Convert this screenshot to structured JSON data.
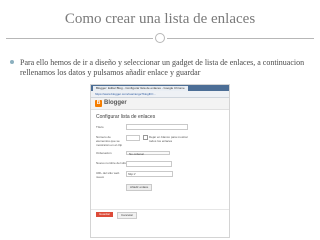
{
  "slide": {
    "title": "Como crear una lista de enlaces",
    "bullet": "Para ello hemos de ir a diseño y seleccionar un gadget de lista de enlaces, a continuacion rellenamos los datos y pulsamos añadir enlace y guardar"
  },
  "screenshot": {
    "browser": {
      "tab_label": "Blogger: Editar Blog - Configurar lista de enlaces - Google Chrome",
      "url": "https://www.blogger.com/rearrange?blogID=..."
    },
    "header": {
      "brand": "Blogger"
    },
    "form": {
      "heading": "Configurar lista de enlaces",
      "fields": {
        "title_label": "Título",
        "max_label": "Número de elementos que se mostrarán en el clip",
        "sort_label": "Ordenación",
        "sort_value": "No ordenar",
        "new_name_label": "Nuevo nombre del sitio",
        "new_url_label": "URL del sitio web nuevo",
        "new_url_value": "http://",
        "add_link_button": "Añadir enlace"
      },
      "checkbox_text": "Dejar en blanco para mostrar todos los enlaces",
      "actions": {
        "save": "Guardar",
        "cancel": "Cancelar"
      }
    }
  }
}
